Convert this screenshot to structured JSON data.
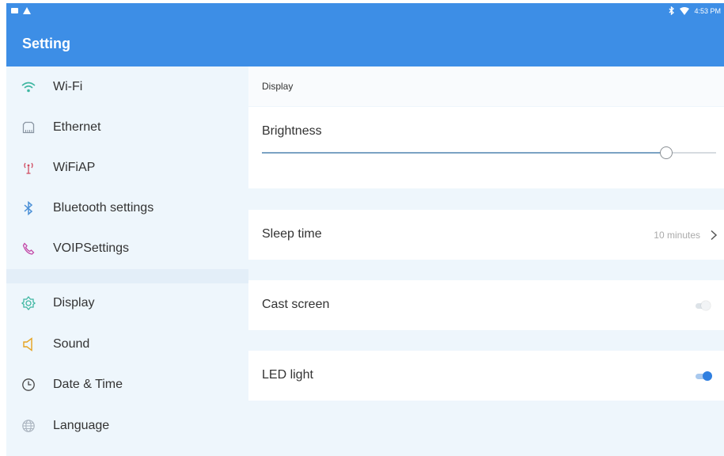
{
  "status_bar": {
    "time": "4:53 PM",
    "left_icons": [
      "message-icon",
      "warning-icon"
    ],
    "right_icons": [
      "bluetooth-icon",
      "wifi-icon"
    ]
  },
  "app_bar": {
    "title": "Setting"
  },
  "sidebar": {
    "items": [
      {
        "label": "Wi-Fi",
        "icon": "wifi-icon"
      },
      {
        "label": "Ethernet",
        "icon": "ethernet-icon"
      },
      {
        "label": "WiFiAP",
        "icon": "hotspot-icon"
      },
      {
        "label": "Bluetooth settings",
        "icon": "bluetooth-icon"
      },
      {
        "label": "VOIPSettings",
        "icon": "phone-icon"
      },
      {
        "label": "Display",
        "icon": "display-icon"
      },
      {
        "label": "Sound",
        "icon": "speaker-icon"
      },
      {
        "label": "Date & Time",
        "icon": "clock-icon"
      },
      {
        "label": "Language",
        "icon": "globe-icon"
      }
    ]
  },
  "main": {
    "section_title": "Display",
    "brightness": {
      "label": "Brightness",
      "level": 0.89
    },
    "sleep_time": {
      "label": "Sleep time",
      "value": "10 minutes"
    },
    "cast_screen": {
      "label": "Cast screen",
      "enabled": false
    },
    "led_light": {
      "label": "LED light",
      "enabled": true
    }
  },
  "colors": {
    "accent": "#3d8ee6",
    "toggle_on": "#2f7fe0",
    "sidebar_bg": "#eef6fc"
  }
}
